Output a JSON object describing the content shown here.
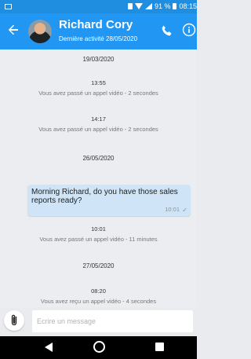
{
  "status_bar": {
    "battery_text": "91 %",
    "time": "08:15"
  },
  "header": {
    "contact_name": "Richard Cory",
    "last_activity": "Dernière activité 28/05/2020",
    "accent_color": "#2196f3",
    "icons": [
      "back-arrow-icon",
      "phone-icon",
      "info-icon"
    ]
  },
  "messages": [
    {
      "kind": "date",
      "text": "19/03/2020"
    },
    {
      "kind": "time",
      "text": "13:55"
    },
    {
      "kind": "system",
      "text": "Vous avez passé un appel vidéo - 2 secondes"
    },
    {
      "kind": "time",
      "text": "14:17"
    },
    {
      "kind": "system",
      "text": "Vous avez passé un appel vidéo - 2 secondes"
    },
    {
      "kind": "date",
      "text": "26/05/2020"
    },
    {
      "kind": "bubble",
      "text": "Morning Richard, do you have those sales reports ready?",
      "time": "10:01"
    },
    {
      "kind": "time",
      "text": "10:01"
    },
    {
      "kind": "system",
      "text": "Vous avez passé un appel vidéo - 11 minutes"
    },
    {
      "kind": "date",
      "text": "27/05/2020"
    },
    {
      "kind": "time",
      "text": "08:20"
    },
    {
      "kind": "system",
      "text": "Vous avez reçu un appel vidéo - 4 secondes"
    }
  ],
  "composer": {
    "placeholder": "Ecrire un message",
    "attach_icon": "paperclip-icon"
  }
}
